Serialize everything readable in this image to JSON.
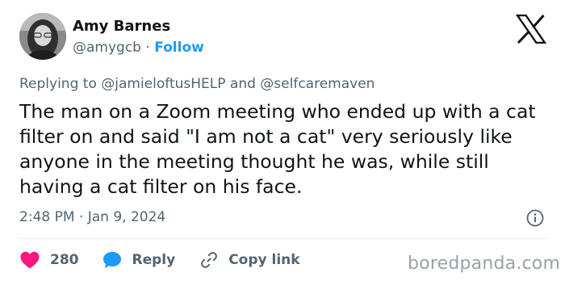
{
  "author": {
    "display_name": "Amy Barnes",
    "handle": "@amygcb",
    "separator": " · ",
    "follow_label": "Follow"
  },
  "reply_context": {
    "prefix": "Replying to ",
    "mention_1": "@jamieloftusHELP",
    "joiner": " and ",
    "mention_2": "@selfcaremaven"
  },
  "tweet": {
    "text": "The man on a Zoom meeting who ended up with a cat filter on and said \"I am not a cat\" very seriously like anyone in the meeting thought he was, while still having a cat filter on his face.",
    "timestamp": "2:48 PM · Jan 9, 2024"
  },
  "actions": {
    "like_count": "280",
    "reply_label": "Reply",
    "copy_link_label": "Copy link"
  },
  "watermark": "boredpanda.com",
  "colors": {
    "accent_blue": "#1d9bf0",
    "like_pink": "#f91880",
    "text_primary": "#0f1419",
    "text_secondary": "#536471",
    "watermark_gray": "#9aa1a7"
  },
  "icons": {
    "brand": "x-logo-icon",
    "info": "info-icon",
    "like": "heart-icon",
    "reply": "speech-bubble-icon",
    "copy_link": "link-icon"
  }
}
